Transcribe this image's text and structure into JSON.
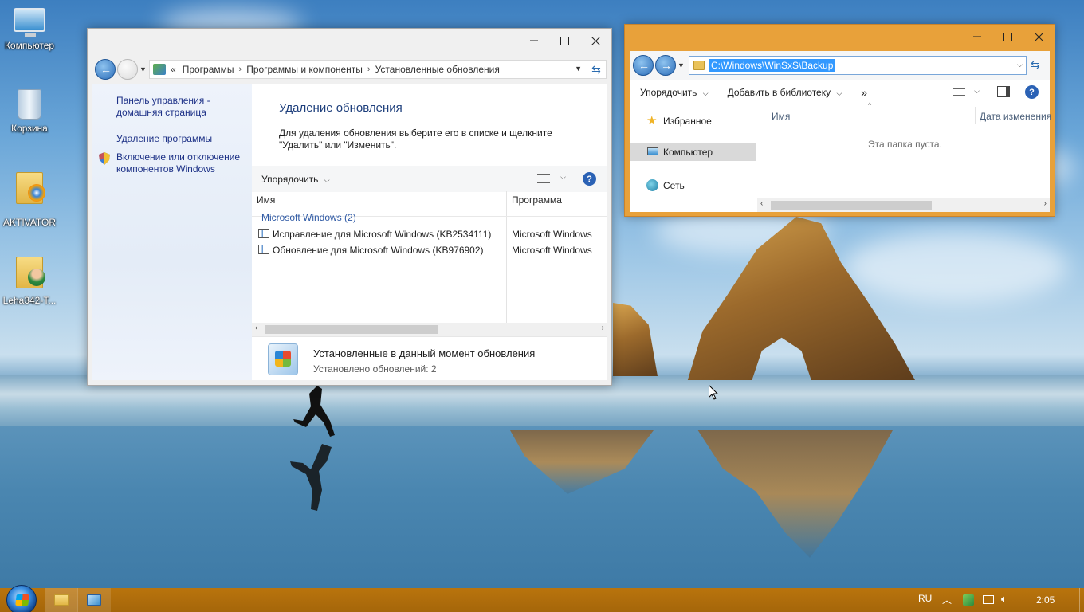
{
  "desktop": {
    "icons": [
      {
        "label": "Компьютер"
      },
      {
        "label": "Корзина"
      },
      {
        "label": "AKTIVATOR"
      },
      {
        "label": "Leha342-T..."
      }
    ]
  },
  "updates_window": {
    "controls": {
      "minimize": "—",
      "maximize": "☐",
      "close": "✕"
    },
    "address": {
      "prefix": "«",
      "crumbs": [
        "Программы",
        "Программы и компоненты",
        "Установленные обновления"
      ]
    },
    "sidebar": {
      "home_link": "Панель управления - домашняя страница",
      "uninstall_link": "Удаление программы",
      "features_link": "Включение или отключение компонентов Windows"
    },
    "main": {
      "title": "Удаление обновления",
      "description": "Для удаления обновления выберите его в списке и щелкните \"Удалить\" или \"Изменить\".",
      "organize_label": "Упорядочить",
      "columns": {
        "name": "Имя",
        "program": "Программа"
      },
      "group_label": "Microsoft Windows (2)",
      "rows": [
        {
          "name": "Исправление для Microsoft Windows (KB2534111)",
          "program": "Microsoft Windows"
        },
        {
          "name": "Обновление для Microsoft Windows (KB976902)",
          "program": "Microsoft Windows"
        }
      ]
    },
    "status": {
      "title": "Установленные в данный момент обновления",
      "count": "Установлено обновлений: 2"
    }
  },
  "explorer_window": {
    "controls": {
      "minimize": "—",
      "maximize": "☐",
      "close": "✕"
    },
    "address": {
      "path": "C:\\Windows\\WinSxS\\Backup"
    },
    "toolbar": {
      "organize_label": "Упорядочить",
      "library_label": "Добавить в библиотеку",
      "more_label": "»"
    },
    "nav": {
      "favorites": "Избранное",
      "computer": "Компьютер",
      "network": "Сеть"
    },
    "columns": {
      "name": "Имя",
      "date": "Дата изменения"
    },
    "empty_text": "Эта папка пуста."
  },
  "taskbar": {
    "language": "RU",
    "clock": "2:05"
  },
  "colors": {
    "accent_orange": "#e8a13a",
    "link_blue": "#1e3287",
    "heading_blue": "#1e3f7c",
    "taskbar": "#a5660a"
  }
}
